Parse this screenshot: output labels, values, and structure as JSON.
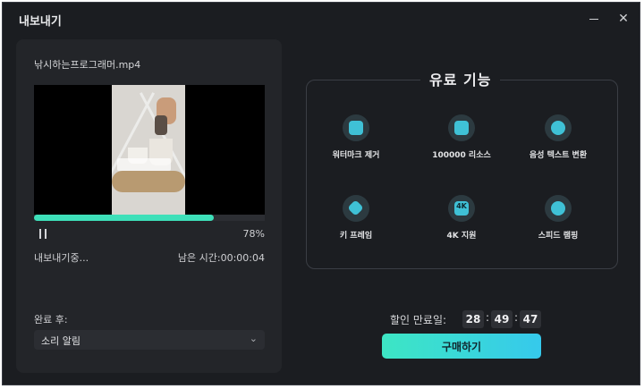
{
  "window": {
    "title": "내보내기",
    "minimize_icon": "minimize-icon",
    "close_icon": "close-icon"
  },
  "export": {
    "filename": "낚시하는프로그래머.mp4",
    "progress_percent": 78,
    "progress_text": "78%",
    "status": "내보내기중...",
    "remaining": "남은 시간:00:00:04",
    "after_label": "완료 후:",
    "after_value": "소리 알림"
  },
  "features": {
    "title": "유료 기능",
    "items": [
      {
        "label": "워터마크 제거",
        "icon": "watermark-remove-icon"
      },
      {
        "label": "100000 리소스",
        "icon": "image-resources-icon"
      },
      {
        "label": "음성 텍스트 변환",
        "icon": "speech-to-text-icon"
      },
      {
        "label": "키 프레임",
        "icon": "keyframe-icon"
      },
      {
        "label": "4K 지원",
        "icon": "4k-icon",
        "badge": "4K"
      },
      {
        "label": "스피드 램핑",
        "icon": "speed-ramping-icon"
      }
    ]
  },
  "promo": {
    "discount_label": "할인 만료일:",
    "timer": {
      "hours": "28",
      "minutes": "49",
      "seconds": "47",
      "sep": ":"
    },
    "buy_label": "구매하기"
  },
  "colors": {
    "accent": "#3ee0b9",
    "button_gradient_start": "#3de6c4",
    "button_gradient_end": "#36c9ec",
    "background": "#1b1d21"
  }
}
